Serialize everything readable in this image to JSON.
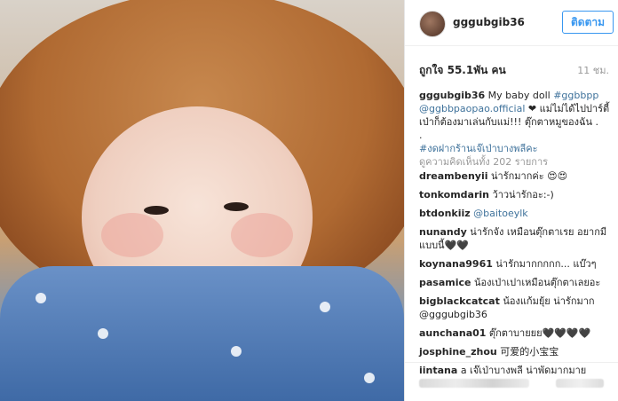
{
  "post": {
    "username": "gggubgib36",
    "follow_label": "ติดตาม",
    "likes_text": "ถูกใจ 55.1พัน คน",
    "time_text": "11 ชม.",
    "caption": {
      "username": "gggubgib36",
      "t1": " My baby doll ",
      "tag1": "#ggbbpp",
      "mention1": "@ggbbpaopao.official",
      "t2": " ❤ แม่ไม่ได้ไปปาร์ตี้ เป่าก็ต้องมาเล่นกับแม่!!! ตุ๊กตาหมูของฉัน .",
      "t3": ".",
      "tag2": "#งดฝากร้านเจ๊เป่าบางพลีคะ"
    },
    "view_all_comments": "ดูความคิดเห็นทั้ง 202 รายการ",
    "comments": [
      {
        "user": "dreambenyii",
        "text": "น่ารักมากค่ะ 😍😍"
      },
      {
        "user": "tonkomdarin",
        "text": "ว้าวน่ารักอะ:-)"
      },
      {
        "user": "btdonkiiz",
        "text": "@baitoeylk"
      },
      {
        "user": "nunandy",
        "text": "น่ารักจัง เหมือนตุ๊กตาเรย อยากมีแบบนี้🖤🖤"
      },
      {
        "user": "koynana9961",
        "text": "น่ารักมากกกกก... แบ๊วๆ"
      },
      {
        "user": "pasamice",
        "text": "น้องเป่าเปาเหมือนตุ๊กตาเลยอะ"
      },
      {
        "user": "bigblackcatcat",
        "text": "น้องแก้มยุ้ย น่ารักมาก @gggubgib36"
      },
      {
        "user": "aunchana01",
        "text": "ตุ๊กตาบายยย🖤🖤🖤🖤"
      },
      {
        "user": "josphine_zhou",
        "text": "可爱的小宝宝"
      },
      {
        "user": "iintana",
        "text": "a เจ๊เป่าบางพลี น่าพัดมากมาย"
      }
    ]
  },
  "colors": {
    "accent": "#3897f0",
    "link": "#3f729b"
  }
}
